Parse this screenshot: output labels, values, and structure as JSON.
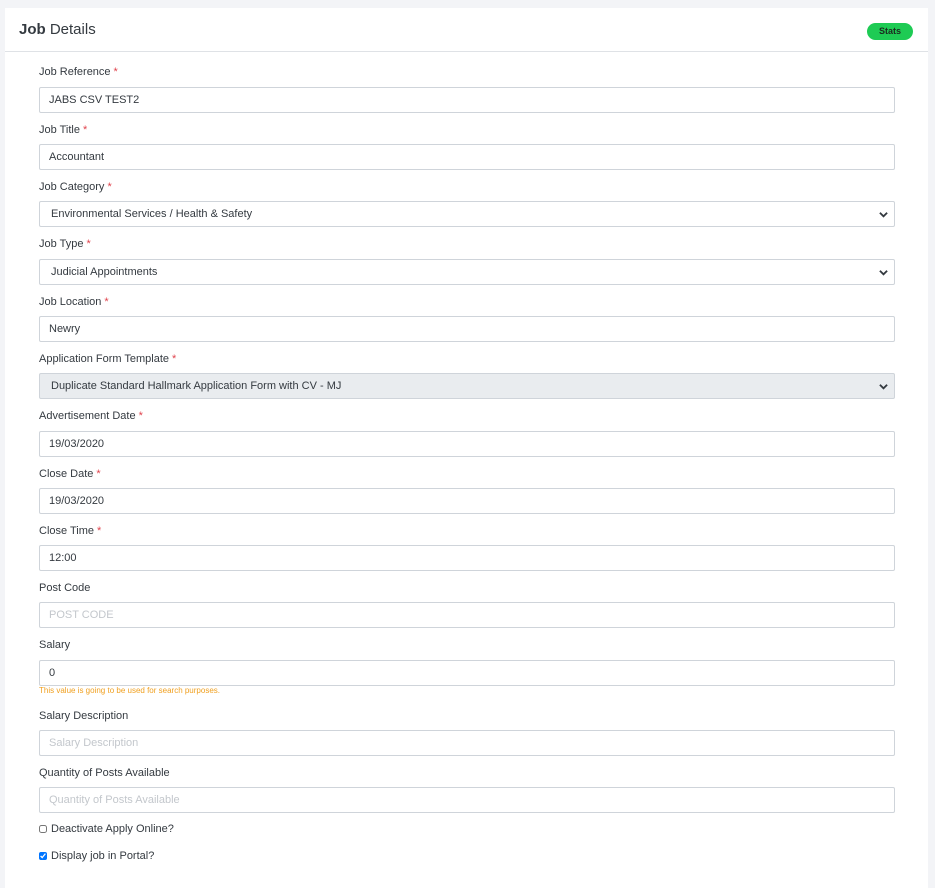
{
  "header": {
    "title_bold": "Job",
    "title_rest": " Details",
    "stats_label": "Stats"
  },
  "required_marker": "*",
  "fields": {
    "job_reference": {
      "label": "Job Reference",
      "value": "JABS CSV TEST2"
    },
    "job_title": {
      "label": "Job Title",
      "value": "Accountant"
    },
    "job_category": {
      "label": "Job Category",
      "value": "Environmental Services / Health & Safety"
    },
    "job_type": {
      "label": "Job Type",
      "value": "Judicial Appointments"
    },
    "job_location": {
      "label": "Job Location",
      "value": "Newry"
    },
    "application_form_template": {
      "label": "Application Form Template",
      "value": "Duplicate Standard Hallmark Application Form with CV - MJ"
    },
    "advertisement_date": {
      "label": "Advertisement Date",
      "value": "19/03/2020"
    },
    "close_date": {
      "label": "Close Date",
      "value": "19/03/2020"
    },
    "close_time": {
      "label": "Close Time",
      "value": "12:00"
    },
    "post_code": {
      "label": "Post Code",
      "value": "",
      "placeholder": "POST CODE"
    },
    "salary": {
      "label": "Salary",
      "value": "0",
      "hint": "This value is going to be used for search purposes."
    },
    "salary_description": {
      "label": "Salary Description",
      "value": "",
      "placeholder": "Salary Description"
    },
    "quantity_of_posts": {
      "label": "Quantity of Posts Available",
      "value": "",
      "placeholder": "Quantity of Posts Available"
    }
  },
  "checkboxes": {
    "deactivate_apply_online": {
      "label": "Deactivate Apply Online?",
      "checked": false
    },
    "display_in_portal": {
      "label": "Display job in Portal?",
      "checked": true
    }
  }
}
